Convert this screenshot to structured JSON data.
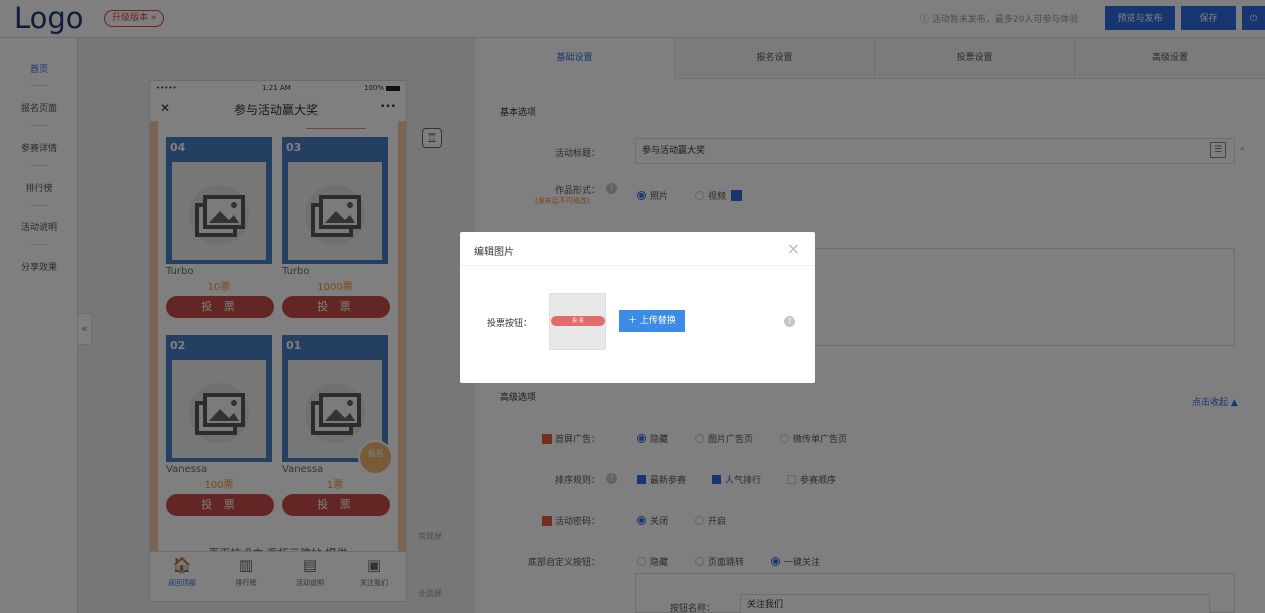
{
  "topbar": {
    "logo": "Logo",
    "upgrade": "升级版本 »",
    "notice": "ⓘ 活动暂未发布，最多20人可参与体验",
    "preview_publish": "预览与发布",
    "save": "保存",
    "power": "⏻"
  },
  "sidebar": {
    "items": [
      "首页",
      "报名页面",
      "参赛详情",
      "排行榜",
      "活动说明",
      "分享效果"
    ]
  },
  "canvas": {
    "collapse": "«",
    "side_notes": [
      "常规屏",
      "全面屏"
    ]
  },
  "phone": {
    "carrier": "•••••",
    "time": "1:21 AM",
    "battery": "100%",
    "nav_close": "✕",
    "title": "参与活动赢大奖",
    "more": "•••",
    "cards": [
      {
        "badge": "04",
        "name": "Turbo",
        "votes": "10票",
        "button": "投 票"
      },
      {
        "badge": "03",
        "name": "Turbo",
        "votes": "1000票",
        "button": "投 票"
      },
      {
        "badge": "02",
        "name": "Vanessa",
        "votes": "100票",
        "button": "投 票"
      },
      {
        "badge": "01",
        "name": "Vanessa",
        "votes": "1票",
        "button": "投 票"
      }
    ],
    "float_label": "报名",
    "footer": "页面技术由 乔拓云建站 提供",
    "tabs": [
      {
        "icon": "🏠",
        "label": "返回顶部"
      },
      {
        "icon": "▥",
        "label": "排行榜"
      },
      {
        "icon": "▤",
        "label": "活动说明"
      },
      {
        "icon": "▣",
        "label": "关注我们"
      }
    ]
  },
  "right": {
    "tabs": [
      "基础设置",
      "报名设置",
      "投票设置",
      "高级设置"
    ],
    "basic_title": "基本选项",
    "activity_title_label": "活动标题：",
    "activity_title_value": "参与活动赢大奖",
    "work_form_label": "作品形式：",
    "work_form_note": "(发布后不可修改)",
    "work_form_options": [
      "照片",
      "视频"
    ],
    "advanced_title": "高级选项",
    "collapse_link": "点击收起 ▲",
    "popup_ad_label": "首屏广告：",
    "popup_ad_options": [
      "隐藏",
      "图片广告页",
      "微传单广告页"
    ],
    "sort_label": "排序规则：",
    "sort_options": [
      "最新参赛",
      "人气排行",
      "参赛顺序"
    ],
    "password_label": "活动密码：",
    "password_options": [
      "关闭",
      "开启"
    ],
    "bottom_btn_label": "底部自定义按钮：",
    "bottom_btn_options": [
      "隐藏",
      "页面跳转",
      "一键关注"
    ],
    "button_name_label": "按钮名称：",
    "button_name_value": "关注我们",
    "required_mark": "*"
  },
  "modal": {
    "title": "编辑图片",
    "close": "×",
    "label": "投票按钮：",
    "preview_button": "投 票",
    "upload": "＋ 上传替换",
    "help": "?"
  }
}
